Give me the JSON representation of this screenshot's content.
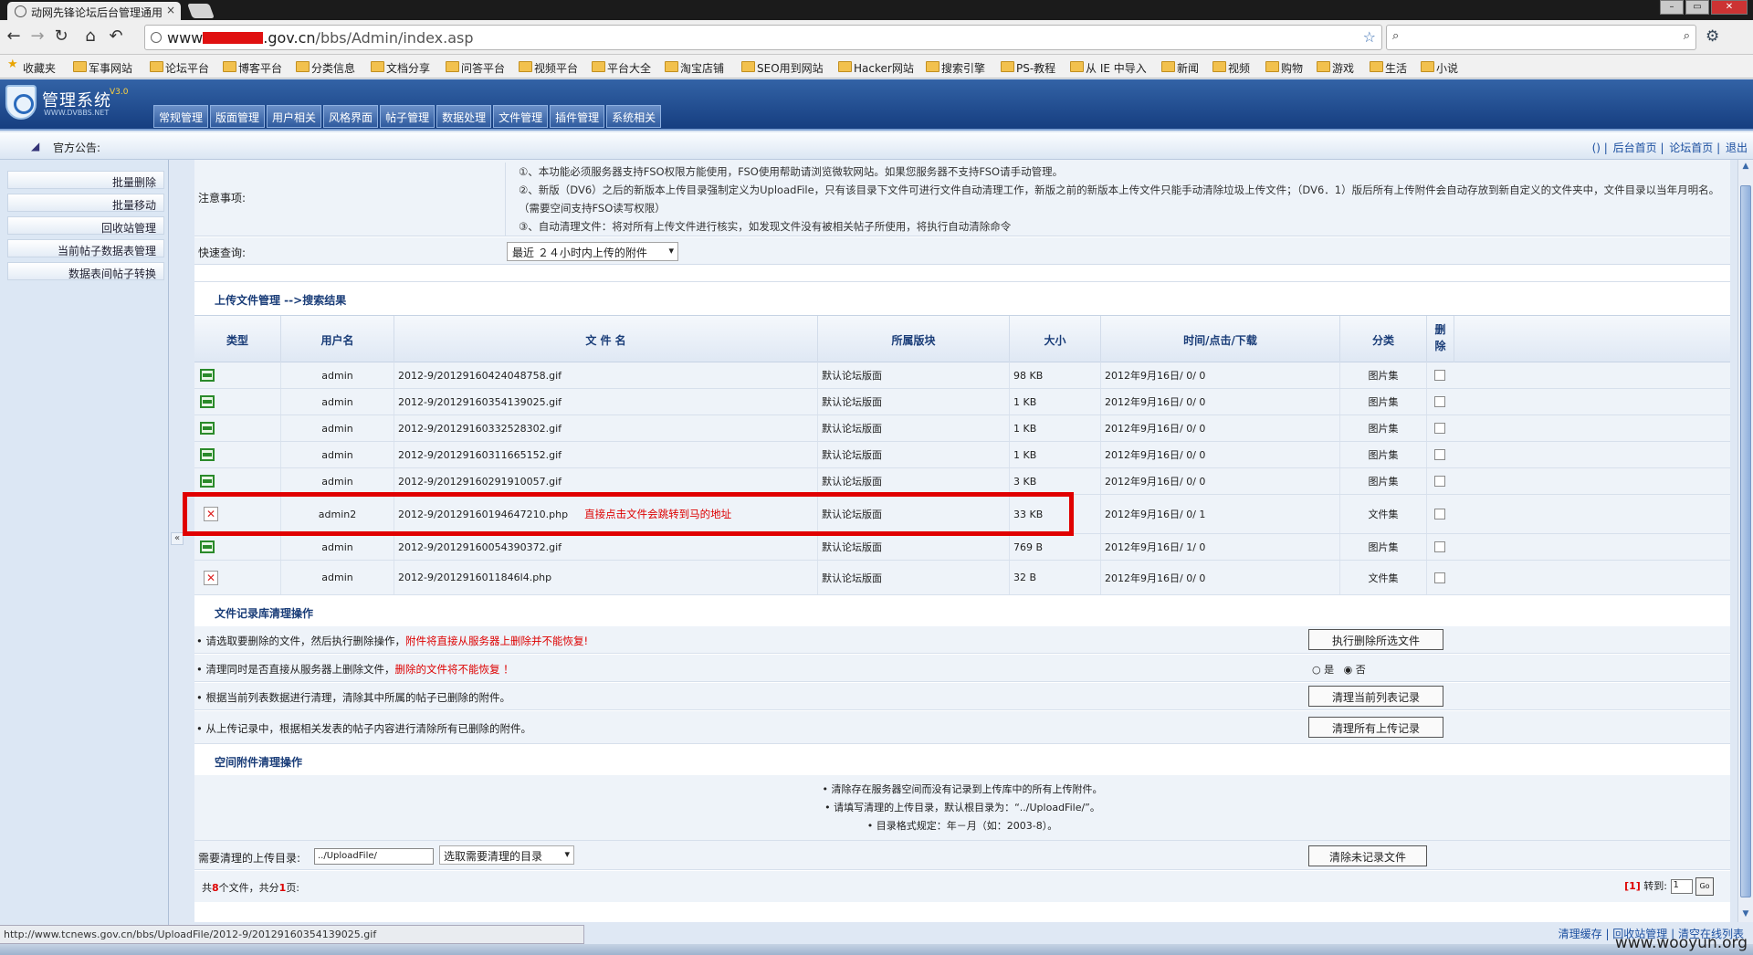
{
  "browser": {
    "tab_title": "动网先锋论坛后台管理通用",
    "tab_close": "×",
    "url_prefix": "www",
    "url_suffix": ".gov.cn",
    "url_path": "/bbs/Admin/index.asp",
    "window_controls": [
      "–",
      "▭",
      "✕"
    ],
    "bookmarks": [
      "收藏夹",
      "军事网站",
      "论坛平台",
      "博客平台",
      "分类信息",
      "文档分享",
      "问答平台",
      "视频平台",
      "平台大全",
      "淘宝店铺",
      "SEO用到网站",
      "Hacker网站",
      "搜索引擎",
      "PS-教程",
      "从 IE 中导入",
      "新闻",
      "视频",
      "购物",
      "游戏",
      "生活",
      "小说"
    ]
  },
  "app": {
    "title": "管理系统",
    "version": "V3.0",
    "subtitle": "WWW.DVBBS.NET",
    "nav": [
      "常规管理",
      "版面管理",
      "用户相关",
      "风格界面",
      "帖子管理",
      "数据处理",
      "文件管理",
      "插件管理",
      "系统相关"
    ],
    "notice_label": "官方公告:",
    "top_links": [
      "()",
      "后台首页",
      "论坛首页",
      "退出"
    ]
  },
  "sidebar": {
    "items": [
      "批量删除",
      "批量移动",
      "回收站管理",
      "当前帖子数据表管理",
      "数据表间帖子转换"
    ]
  },
  "notice": {
    "label": "注意事项:",
    "line1": "①、本功能必须服务器支持FSO权限方能使用，FSO使用帮助请浏览微软网站。如果您服务器不支持FSO请手动管理。",
    "line2": "②、新版（DV6）之后的新版本上传目录强制定义为UploadFile，只有该目录下文件可进行文件自动清理工作，新版之前的新版本上传文件只能手动清除垃圾上传文件；（DV6．1）版后所有上传附件会自动存放到新自定义的文件夹中，文件目录以当年月明名。（需要空间支持FSO读写权限）",
    "line3": "③、自动清理文件：将对所有上传文件进行核实，如发现文件没有被相关帖子所使用，将执行自动清除命令"
  },
  "quick": {
    "label": "快速查询:",
    "selected": "最近 ２４小时内上传的附件"
  },
  "files": {
    "section_title": "上传文件管理 -->搜索结果",
    "headers": [
      "类型",
      "用户名",
      "文 件 名",
      "所属版块",
      "大小",
      "时间/点击/下载",
      "分类",
      "删除"
    ],
    "rows": [
      {
        "type": "gif",
        "user": "admin",
        "file": "2012-9/20129160424048758.gif",
        "board": "默认论坛版面",
        "size": "98 KB",
        "time": "2012年9月16日/ 0/ 0",
        "category": "图片集"
      },
      {
        "type": "gif",
        "user": "admin",
        "file": "2012-9/20129160354139025.gif",
        "board": "默认论坛版面",
        "size": "1 KB",
        "time": "2012年9月16日/ 0/ 0",
        "category": "图片集"
      },
      {
        "type": "gif",
        "user": "admin",
        "file": "2012-9/20129160332528302.gif",
        "board": "默认论坛版面",
        "size": "1 KB",
        "time": "2012年9月16日/ 0/ 0",
        "category": "图片集"
      },
      {
        "type": "gif",
        "user": "admin",
        "file": "2012-9/20129160311665152.gif",
        "board": "默认论坛版面",
        "size": "1 KB",
        "time": "2012年9月16日/ 0/ 0",
        "category": "图片集"
      },
      {
        "type": "gif",
        "user": "admin",
        "file": "2012-9/20129160291910057.gif",
        "board": "默认论坛版面",
        "size": "3 KB",
        "time": "2012年9月16日/ 0/ 0",
        "category": "图片集"
      },
      {
        "type": "php",
        "user": "admin2",
        "file": "2012-9/20129160194647210.php",
        "note": "直接点击文件会跳转到马的地址",
        "board": "默认论坛版面",
        "size": "33 KB",
        "time": "2012年9月16日/ 0/ 1",
        "category": "文件集"
      },
      {
        "type": "gif",
        "user": "admin",
        "file": "2012-9/20129160054390372.gif",
        "board": "默认论坛版面",
        "size": "769 B",
        "time": "2012年9月16日/ 1/ 0",
        "category": "图片集"
      },
      {
        "type": "php",
        "user": "admin",
        "file": "2012-9/2012916011846l4.php",
        "board": "默认论坛版面",
        "size": "32 B",
        "time": "2012年9月16日/ 0/ 0",
        "category": "文件集"
      }
    ]
  },
  "cleanup": {
    "section_title": "文件记录库清理操作",
    "row1_text": "请选取要删除的文件，然后执行删除操作，",
    "row1_red": "附件将直接从服务器上删除并不能恢复!",
    "row1_button": "执行删除所选文件",
    "row2_text": "清理同时是否直接从服务器上删除文件，",
    "row2_red": "删除的文件将不能恢复 ！",
    "radio_yes": "是",
    "radio_no": "否",
    "row3_text": "根据当前列表数据进行清理，清除其中所属的帖子已删除的附件。",
    "row3_button": "清理当前列表记录",
    "row4_text": "从上传记录中，根据相关发表的帖子内容进行清除所有已删除的附件。",
    "row4_button": "清理所有上传记录"
  },
  "space": {
    "section_title": "空间附件清理操作",
    "line1": "清除存在服务器空间而没有记录到上传库中的所有上传附件。",
    "line2": "请填写清理的上传目录，默认根目录为：“../UploadFile/”。",
    "line3": "目录格式规定：年－月（如：2003-8）。",
    "dir_label": "需要清理的上传目录:",
    "dir_value": "../UploadFile/",
    "dir_select": "选取需要清理的目录",
    "clean_button": "清除未记录文件"
  },
  "footer": {
    "count_pre": "共",
    "count_n": "8",
    "count_mid": "个文件，共分",
    "count_p": "1",
    "count_post": "页:",
    "cur_page": "[1]",
    "goto_label": "转到:",
    "goto_value": "1",
    "go_label": "Go"
  },
  "status": {
    "url": "http://www.tcnews.gov.cn/bbs/UploadFile/2012-9/20129160354139025.gif",
    "bottom_links": [
      "清理缓存",
      "回收站管理",
      "清空在线列表"
    ],
    "watermark": "www.wooyun.org"
  },
  "colors": {
    "header_blue": "#1f4a8c",
    "highlight_red": "#e00000",
    "row_bg": "#eef3f9"
  }
}
